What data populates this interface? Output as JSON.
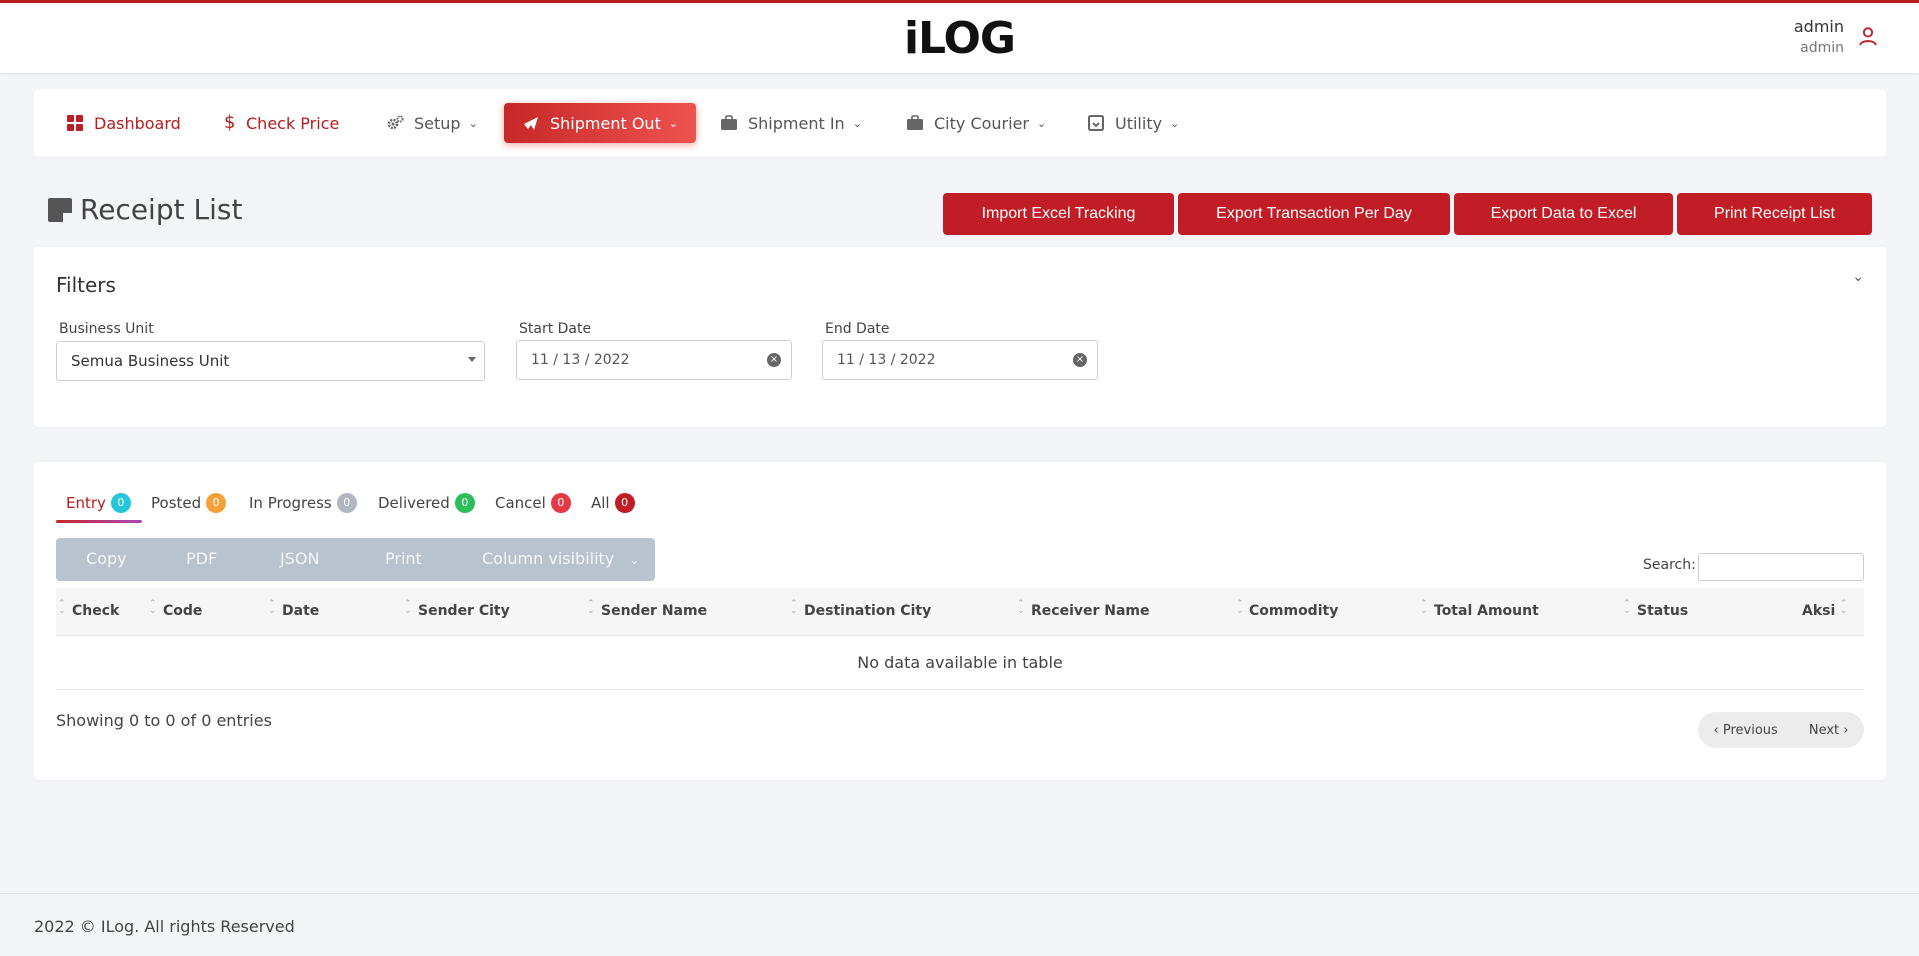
{
  "header": {
    "logo": "iLOG",
    "user_name": "admin",
    "user_role": "admin"
  },
  "nav": [
    {
      "label": "Dashboard",
      "icon": "dashboard-icon"
    },
    {
      "label": "Check Price",
      "icon": "dollar-icon"
    },
    {
      "label": "Setup",
      "icon": "gears-icon"
    },
    {
      "label": "Shipment Out",
      "icon": "plane-icon",
      "active": true
    },
    {
      "label": "Shipment In",
      "icon": "briefcase-icon"
    },
    {
      "label": "City Courier",
      "icon": "briefcase-icon"
    },
    {
      "label": "Utility",
      "icon": "archive-icon"
    }
  ],
  "page": {
    "title": "Receipt List",
    "actions": [
      "Import Excel Tracking",
      "Export Transaction Per Day",
      "Export Data to Excel",
      "Print Receipt List"
    ]
  },
  "filters": {
    "title": "Filters",
    "business_unit_label": "Business Unit",
    "business_unit_value": "Semua Business Unit",
    "start_date_label": "Start Date",
    "start_date_value": "11 / 13 / 2022",
    "end_date_label": "End Date",
    "end_date_value": "11 / 13 / 2022"
  },
  "tabs": [
    {
      "label": "Entry",
      "count": "0",
      "color": "#26c6da"
    },
    {
      "label": "Posted",
      "count": "0",
      "color": "#f6a03a"
    },
    {
      "label": "In Progress",
      "count": "0",
      "color": "#b0b7c0"
    },
    {
      "label": "Delivered",
      "count": "0",
      "color": "#2ebd5c"
    },
    {
      "label": "Cancel",
      "count": "0",
      "color": "#e53945"
    },
    {
      "label": "All",
      "count": "0",
      "color": "#c11d26"
    }
  ],
  "table_buttons": [
    "Copy",
    "PDF",
    "JSON",
    "Print",
    "Column visibility"
  ],
  "search_label": "Search:",
  "columns": [
    "Check",
    "Code",
    "Date",
    "Sender City",
    "Sender Name",
    "Destination City",
    "Receiver Name",
    "Commodity",
    "Total Amount",
    "Status",
    "Aksi"
  ],
  "empty_message": "No data available in table",
  "info": "Showing 0 to 0 of 0 entries",
  "pager": {
    "previous": "‹ Previous",
    "next": "Next ›"
  },
  "footer": "2022 © ILog. All rights Reserved",
  "colors": {
    "brand_red": "#c11d26",
    "nav_red": "#b71c1c"
  }
}
